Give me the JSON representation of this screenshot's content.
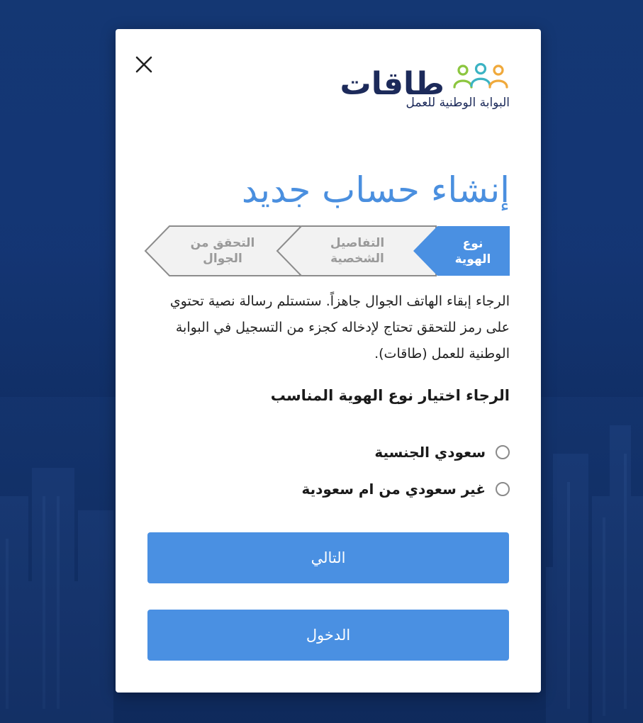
{
  "modal": {
    "logo": {
      "word": "طاقات",
      "subtitle": "البوابة الوطنية للعمل",
      "icon": "three-people-icon",
      "colors": [
        "#3bb3c3",
        "#f0a93b",
        "#8cc63f"
      ]
    },
    "close_icon": "close-icon",
    "title": "إنشاء حساب جديد",
    "steps": [
      {
        "label_line1": "نوع",
        "label_line2": "الهوية",
        "active": true
      },
      {
        "label_line1": "التفاصيل",
        "label_line2": "الشخصية",
        "active": false
      },
      {
        "label_line1": "التحقق من",
        "label_line2": "الجوال",
        "active": false
      }
    ],
    "info_text": "الرجاء إبقاء الهاتف الجوال جاهزاً. ستستلم رسالة نصية تحتوي على رمز للتحقق تحتاج لإدخاله كجزء من التسجيل في البوابة الوطنية للعمل (طاقات).",
    "id_type_heading": "الرجاء اختيار نوع الهوية المناسب",
    "id_type_options": [
      {
        "label": "سعودي الجنسية",
        "selected": false
      },
      {
        "label": "غير سعودي من ام سعودية",
        "selected": false
      }
    ],
    "next_button": "التالي",
    "login_button": "الدخول"
  },
  "colors": {
    "accent": "#4a90e2",
    "title": "#4a8fdf",
    "step_inactive_bg": "#f2f2f2",
    "step_inactive_text": "#9a9a9a",
    "background": "#143773"
  }
}
